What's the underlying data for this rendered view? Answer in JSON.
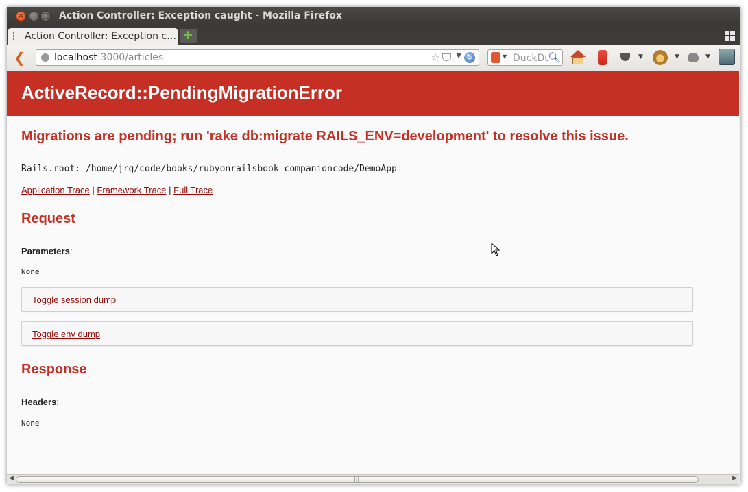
{
  "window": {
    "title": "Action Controller: Exception caught - Mozilla Firefox",
    "buttons": {
      "close": "×",
      "minimize": "–",
      "maximize": "□"
    }
  },
  "tabs": [
    {
      "label": "Action Controller: Exception c…",
      "active": true
    }
  ],
  "new_tab_label": "+",
  "navbar": {
    "back_glyph": "❮",
    "url_host": "localhost",
    "url_rest": ":3000/articles",
    "search_placeholder": "DuckDu",
    "icons": [
      "back-icon",
      "globe-icon",
      "bookmark-star-icon",
      "pocket-icon",
      "reload-icon",
      "duckduckgo-icon",
      "search-icon",
      "home-icon",
      "jar-addon-icon",
      "pocket-toolbar-icon",
      "greasemonkey-icon",
      "bug-addon-icon",
      "evernote-icon"
    ]
  },
  "page": {
    "error_title": "ActiveRecord::PendingMigrationError",
    "message": "Migrations are pending; run 'rake db:migrate RAILS_ENV=development' to resolve this issue.",
    "rails_root": "Rails.root: /home/jrg/code/books/rubyonrailsbook-companioncode/DemoApp",
    "trace_links": {
      "application": "Application Trace",
      "framework": "Framework Trace",
      "full": "Full Trace",
      "separator": "|"
    },
    "request": {
      "heading": "Request",
      "parameters_label": "Parameters",
      "parameters_suffix": ":",
      "parameters_value": "None",
      "toggle_session": "Toggle session dump",
      "toggle_env": "Toggle env dump"
    },
    "response": {
      "heading": "Response",
      "headers_label": "Headers",
      "headers_suffix": ":",
      "headers_value": "None"
    }
  },
  "colors": {
    "header_red": "#c52f24",
    "link_red": "#980905",
    "page_bg": "#fafafa"
  }
}
